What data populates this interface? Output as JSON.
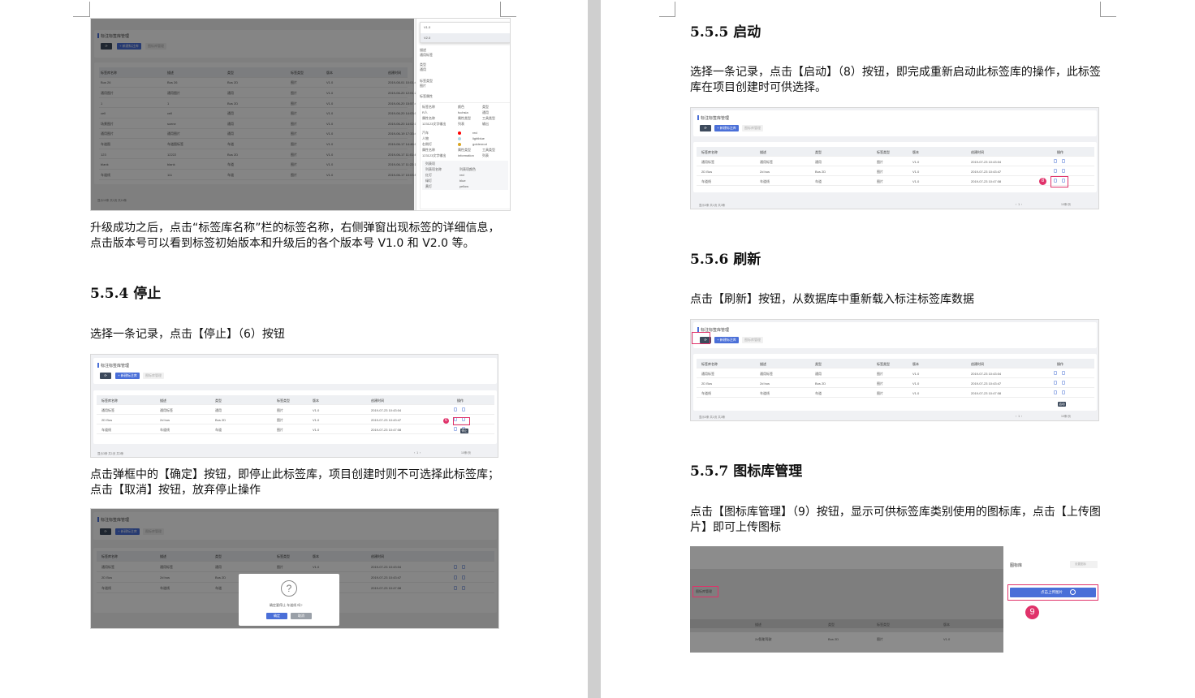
{
  "left_page": {
    "figure1": {
      "list_title": "标注标签库管理",
      "toolbar": {
        "new_label": "+ 新建标注库",
        "icon_lib_label": "图标库管理"
      },
      "columns": [
        "标签库名称",
        "描述",
        "类型",
        "标签类型",
        "版本",
        "创建时间"
      ],
      "rows": [
        [
          "Bus 26",
          "Bus 26",
          "Bus 2D",
          "图片",
          "V1.0",
          "2019-08-01 10:01:46"
        ],
        [
          "通用图片",
          "通用图片",
          "通用",
          "图片",
          "V1.0",
          "2019-06-20 12:01:27"
        ],
        [
          "1",
          "1",
          "Bus 2D",
          "图片",
          "V1.0",
          "2019-06-20 15:57:47"
        ],
        [
          "cell",
          "cell",
          "通用",
          "图片",
          "V1.0",
          "2019-06-20 14:03:07"
        ],
        [
          "场景图片",
          "scene",
          "通用",
          "图片",
          "V1.0",
          "2019-06-20 14:02:12"
        ],
        [
          "通用图片",
          "通用图片",
          "通用",
          "图片",
          "V1.0",
          "2019-06-19 17:33:44"
        ],
        [
          "车道图",
          "车道图标签",
          "车道",
          "图片",
          "V1.0",
          "2019-06-17 14:46:04"
        ],
        [
          "123",
          "12222",
          "Bus 2D",
          "图片",
          "V1.0",
          "2019-06-17 11:01:44"
        ],
        [
          "blank",
          "blank",
          "车道",
          "图片",
          "V1.0",
          "2019-06-17 11:22:17"
        ],
        [
          "车道线",
          "111",
          "车道",
          "图片",
          "V1.0",
          "2019-06-17 10:03:58"
        ]
      ],
      "footer": "显示10条 共1页 共16条",
      "version_dropdown": [
        "V1.0",
        "V2.0"
      ],
      "detail_labels": [
        "描述",
        "通用标签",
        "类型",
        "通用",
        "标签类型",
        "图片",
        "标签属性"
      ],
      "detail_block": [
        [
          "标签名称",
          "颜色",
          "类型"
        ],
        [
          "R人",
          "fuchsia",
          "通用"
        ],
        [
          "属性名称",
          "属性类型",
          "工具类型"
        ],
        [
          "123123文字输出",
          "列表",
          "输出"
        ]
      ],
      "detail_block2": [
        [
          "汽车",
          "",
          "red"
        ],
        [
          "人物",
          "",
          "lightblue"
        ],
        [
          "右侧灯",
          "",
          "goldenrod"
        ]
      ],
      "detail_block3": [
        [
          "属性名称",
          "属性类型",
          "工具类型"
        ],
        [
          "123123文字输出",
          "information",
          "列表"
        ]
      ],
      "attr_table_title": "列表项",
      "attr_table": [
        [
          "列表项名称",
          "列表项颜色"
        ],
        [
          "红灯",
          "red"
        ],
        [
          "绿灯",
          "blue"
        ],
        [
          "黄灯",
          "yellow"
        ]
      ]
    },
    "para1": "升级成功之后，点击“标签库名称”栏的标签名称，右侧弹窗出现标签的详细信息，点击版本号可以看到标签初始版本和升级后的各个版本号 V1.0 和 V2.0 等。",
    "heading_554": "5.5.4 停止",
    "para2": "选择一条记录，点击【停止】（6）按钮",
    "figure2": {
      "list_title": "标注标签库管理",
      "toolbar": {
        "new_label": "+ 新建标注库",
        "icon_lib_label": "图标库管理"
      },
      "columns": [
        "标签库名称",
        "描述",
        "类型",
        "标签类型",
        "版本",
        "创建时间",
        "操作"
      ],
      "rows": [
        [
          "通用标签",
          "通用标签",
          "通用",
          "图片",
          "V1.0",
          "2019-07-23 10:43:04"
        ],
        [
          "2D Bus",
          "2d bus",
          "Bus 2D",
          "图片",
          "V1.0",
          "2019-07-23 10:43:47"
        ],
        [
          "车道线",
          "车道线",
          "车道",
          "图片",
          "V1.0",
          "2019-07-23 10:47:08"
        ]
      ],
      "badge": "6",
      "tooltip": "停止",
      "footer": "显示3条 共1页 共3条",
      "pager": "10条/页"
    },
    "para3": "点击弹框中的【确定】按钮，即停止此标签库，项目创建时则不可选择此标签库；点击【取消】按钮，放弃停止操作",
    "figure3": {
      "list_title": "标注标签库管理",
      "toolbar": {
        "new_label": "+ 新建标注库",
        "icon_lib_label": "图标库管理"
      },
      "columns": [
        "标签库名称",
        "描述",
        "类型",
        "标签类型",
        "版本",
        "创建时间"
      ],
      "rows": [
        [
          "通用标签",
          "通用标签",
          "通用",
          "图片",
          "V1.0",
          "2019-07-23 10:43:04"
        ],
        [
          "2D Bus",
          "2d bus",
          "Bus 2D",
          "图片",
          "V1.0",
          "2019-07-23 10:43:47"
        ],
        [
          "车道线",
          "车道线",
          "车道",
          "图片",
          "V1.0",
          "2019-07-23 10:47:08"
        ]
      ],
      "dialog": {
        "symbol": "?",
        "message": "确定要停止 车道线 吗?",
        "ok": "确定",
        "cancel": "取消"
      }
    }
  },
  "right_page": {
    "heading_555": "5.5.5 启动",
    "para1": "选择一条记录，点击【启动】（8）按钮，即完成重新启动此标签库的操作，此标签库在项目创建时可供选择。",
    "figure4": {
      "list_title": "标注标签库管理",
      "toolbar": {
        "new_label": "+ 新建标注库",
        "icon_lib_label": "图标库管理"
      },
      "columns": [
        "标签库名称",
        "描述",
        "类型",
        "标签类型",
        "版本",
        "创建时间",
        "操作"
      ],
      "rows": [
        [
          "通用标签",
          "通用标签",
          "通用",
          "图片",
          "V1.0",
          "2019-07-23 10:43:04"
        ],
        [
          "2D Bus",
          "2d bus",
          "Bus 2D",
          "图片",
          "V1.0",
          "2019-07-23 10:43:47"
        ],
        [
          "车道线",
          "车道线",
          "车道",
          "图片",
          "V1.0",
          "2019-07-23 10:47:08"
        ]
      ],
      "badge": "8",
      "footer": "显示3条 共1页 共3条",
      "pager": "10条/页"
    },
    "heading_556": "5.5.6 刷新",
    "para2": "点击【刷新】按钮，从数据库中重新载入标注标签库数据",
    "figure5": {
      "list_title": "标注标签库管理",
      "toolbar": {
        "new_label": "+ 新建标注库",
        "icon_lib_label": "图标库管理"
      },
      "columns": [
        "标签库名称",
        "描述",
        "类型",
        "标签类型",
        "版本",
        "创建时间",
        "操作"
      ],
      "rows": [
        [
          "通用标签",
          "通用标签",
          "通用",
          "图片",
          "V1.0",
          "2019-07-23 10:43:04"
        ],
        [
          "2D Bus",
          "2d bus",
          "Bus 2D",
          "图片",
          "V1.0",
          "2019-07-23 10:43:47"
        ],
        [
          "车道线",
          "车道线",
          "车道",
          "图片",
          "V1.0",
          "2019-07-23 10:47:08"
        ]
      ],
      "tooltip": "启动",
      "footer": "显示3条 共1页 共3条",
      "pager": "10条/页"
    },
    "heading_557": "5.5.7 图标库管理",
    "para3": "点击【图标库管理】（9）按钮，显示可供标签库类别使用的图标库，点击【上传图片】即可上传图标",
    "figure6": {
      "button_label": "图标库管理",
      "columns": [
        "描述",
        "类型",
        "标签类型",
        "版本"
      ],
      "row": [
        "2d智能驾驶",
        "Bus 2D",
        "图片",
        "V1.0"
      ],
      "panel_title": "图标库",
      "panel_search": "设置图标",
      "upload_label": "点击上传图片",
      "badge": "9"
    }
  }
}
